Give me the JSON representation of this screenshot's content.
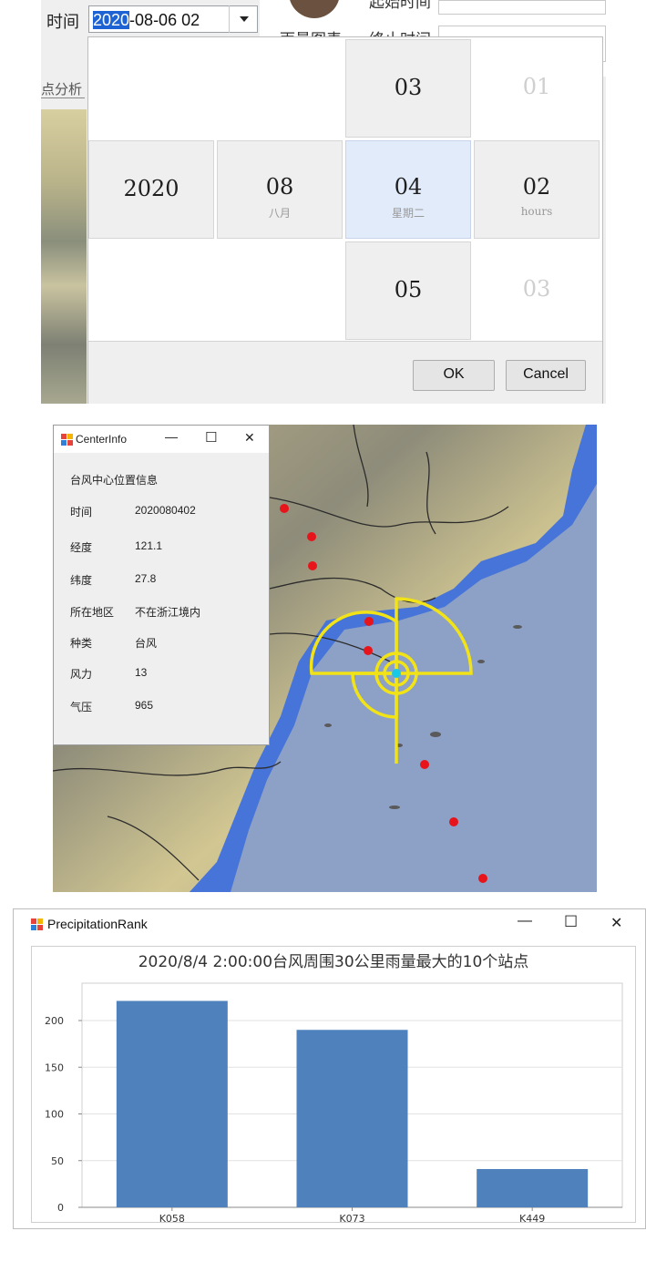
{
  "picker": {
    "label": "时间",
    "value_selected": "2020",
    "value_rest": "-08-06 02",
    "bg_label_1": "起始时间",
    "bg_label_2": "雨量图表",
    "bg_label_3": "终止时间",
    "side_tab": "点分析",
    "year": "2020",
    "month": "08",
    "month_sub": "八月",
    "day_prev": "03",
    "day": "04",
    "day_sub": "星期二",
    "day_next": "05",
    "hour_prev": "01",
    "hour": "02",
    "hour_sub": "hours",
    "hour_next": "03",
    "ok": "OK",
    "cancel": "Cancel"
  },
  "center_info": {
    "title": "CenterInfo",
    "heading": "台风中心位置信息",
    "rows": [
      {
        "label": "时间",
        "value": "2020080402"
      },
      {
        "label": "经度",
        "value": "121.1"
      },
      {
        "label": "纬度",
        "value": "27.8"
      },
      {
        "label": "所在地区",
        "value": "不在浙江境内"
      },
      {
        "label": "种类",
        "value": "台风"
      },
      {
        "label": "风力",
        "value": "13"
      },
      {
        "label": "气压",
        "value": "965"
      }
    ]
  },
  "window_controls": {
    "minimize": "—",
    "maximize": "☐",
    "close": "✕"
  },
  "precip_window": {
    "title": "PrecipitationRank"
  },
  "colors": {
    "station_dot": "#e8141b",
    "typhoon_ring": "#f2e317",
    "bar": "#4f81bd",
    "selection": "#1e63d3"
  },
  "chart_data": {
    "type": "bar",
    "title": "2020/8/4 2:00:00台风周围30公里雨量最大的10个站点",
    "categories": [
      "K058",
      "K073",
      "K449"
    ],
    "values": [
      221,
      190,
      41
    ],
    "yticks": [
      0,
      50,
      100,
      150,
      200
    ],
    "ylim": [
      0,
      240
    ],
    "grid": true
  }
}
